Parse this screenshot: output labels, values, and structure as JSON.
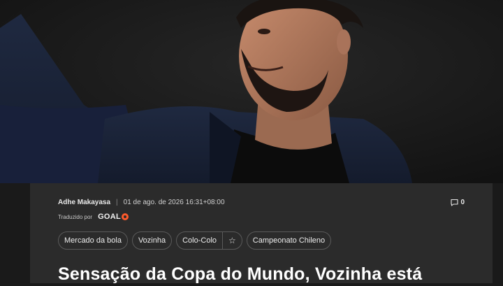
{
  "article": {
    "author": "Adhe Makayasa",
    "separator": "|",
    "datetime": "01 de ago. de 2026 16:31+08:00",
    "comment_count": "0",
    "translated_by_label": "Traduzido por",
    "source_brand": "GOAL",
    "headline": "Sensação da Copa do Mundo, Vozinha está"
  },
  "tags": [
    {
      "label": "Mercado da bola"
    },
    {
      "label": "Vozinha"
    },
    {
      "label": "Colo-Colo",
      "favorite_icon": "star-outline-icon"
    },
    {
      "label": "Campeonato Chileno"
    }
  ],
  "icons": {
    "comment": "comment-bubble-icon",
    "brand_mark": "goal-logo-icon"
  },
  "colors": {
    "page_background": "#1a1a1a",
    "card_background": "#2b2b2b",
    "brand_accent": "#ff5a2b",
    "headline_text": "#ffffff"
  }
}
